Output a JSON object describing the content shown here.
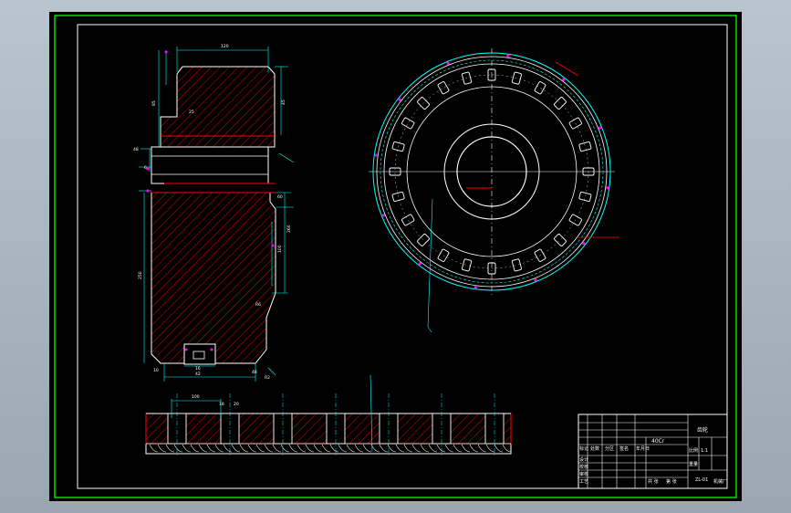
{
  "sheet": {
    "frame_color": "#00ff00",
    "background": "#000000",
    "outline_color": "#ffffff",
    "section_color": "#ff0000",
    "hatch_color": "#ff0000",
    "dimension_color": "#00ffff",
    "center_line_color": "#00ffff",
    "marker_color": "#ff00ff"
  },
  "side_view": {
    "dims": {
      "top_width": "120",
      "flange_height": "85",
      "upper_right": "45",
      "left_step": "25",
      "shaft_dia": "48",
      "left_mark": "6",
      "body_height": "250",
      "right_upper": "60",
      "right_mid": "100",
      "right_lower": "260",
      "inner_r": "R6",
      "bottom_left": "10",
      "slot_w": "16",
      "bottom_w": "42",
      "bottom_r": "48",
      "root_r": "R2"
    }
  },
  "front_view": {
    "pocket_count": 24,
    "dims": [
      "Ø0",
      "Ø0",
      "Ø0",
      "Ø0",
      "Ø0",
      "Ø0",
      "Ø0",
      "Ø0",
      "Ø0",
      "Ø0",
      "Ø0",
      "Ø0"
    ]
  },
  "development_view": {
    "dims": {
      "pitch": "100",
      "slot_a": "18",
      "slot_b": "20"
    },
    "segments": 7
  },
  "title_block": {
    "left_rows": [
      "标记",
      "设计",
      "校核",
      "审核",
      "工艺",
      "标准化"
    ],
    "mid_rows": [
      "处数",
      "分区",
      "签名",
      "年月日"
    ],
    "material": "40Cr",
    "scale_label": "比例",
    "scale_value": "1:1",
    "weight_label": "重量",
    "sheet_label": "共 张",
    "sheet_no": "第 张",
    "part_name": "齿轮",
    "drawing_no": "ZL-01",
    "company": "机械厂"
  }
}
